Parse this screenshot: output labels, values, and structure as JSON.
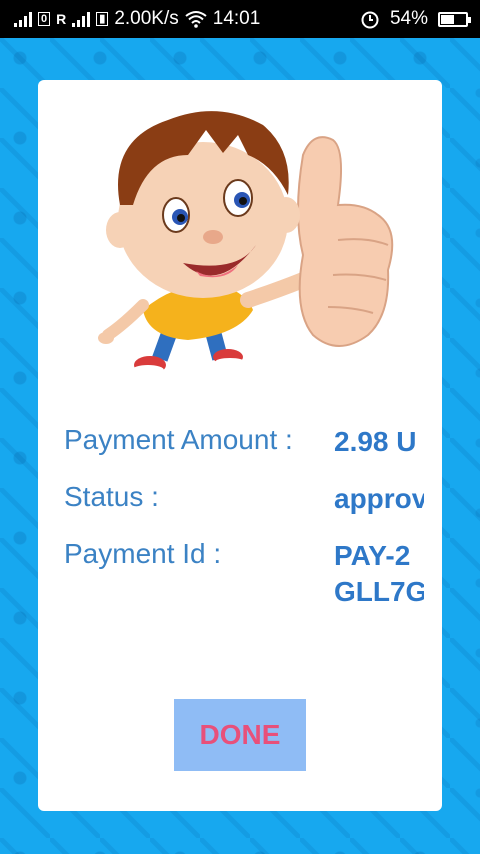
{
  "status_bar": {
    "network_speed": "2.00K/s",
    "time": "14:01",
    "battery": "54%",
    "battery_level": 0.54,
    "icons": [
      "signal-icon",
      "sim-icon",
      "roaming-signal-icon",
      "wifi-icon",
      "alarm-icon",
      "battery-icon"
    ],
    "sim1": "0",
    "sim2": "R"
  },
  "payment": {
    "amount_label": "Payment Amount :",
    "amount_value": "2.98 U",
    "status_label": "Status :",
    "status_value": "approv",
    "id_label": "Payment Id :",
    "id_value": "PAY-2\nGLL7G"
  },
  "done_button": "DONE",
  "colors": {
    "background": "#1aa9ee",
    "label_blue": "#3b82c4",
    "value_blue": "#2e78c8",
    "button_bg": "#8fbcf5",
    "button_text": "#e8507a"
  }
}
